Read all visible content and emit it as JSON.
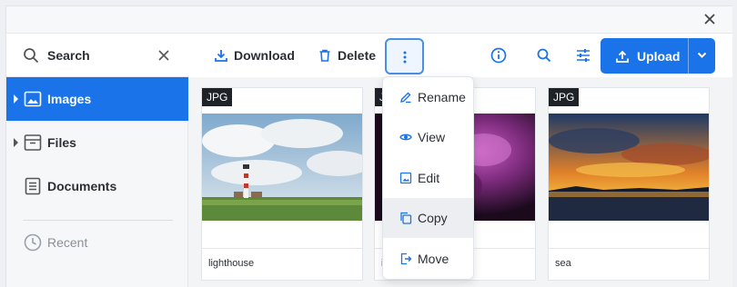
{
  "window": {
    "close_icon": "close-icon"
  },
  "sidebar": {
    "search_label": "Search",
    "items": [
      {
        "label": "Images",
        "icon": "image-icon",
        "active": true
      },
      {
        "label": "Files",
        "icon": "archive-icon"
      },
      {
        "label": "Documents",
        "icon": "document-icon"
      },
      {
        "label": "Recent",
        "icon": "clock-icon",
        "disabled": true
      }
    ]
  },
  "toolbar": {
    "download_label": "Download",
    "delete_label": "Delete",
    "upload_label": "Upload"
  },
  "files": [
    {
      "type": "JPG",
      "name": "lighthouse"
    },
    {
      "type": "JPG",
      "name": "i"
    },
    {
      "type": "JPG",
      "name": "sea"
    }
  ],
  "context_menu": [
    {
      "label": "Rename",
      "icon": "pencil-icon"
    },
    {
      "label": "View",
      "icon": "eye-icon"
    },
    {
      "label": "Edit",
      "icon": "image-edit-icon"
    },
    {
      "label": "Copy",
      "icon": "copy-icon",
      "hover": true
    },
    {
      "label": "Move",
      "icon": "move-icon"
    }
  ],
  "colors": {
    "accent": "#1a73e8",
    "badge": "#1f2328"
  }
}
